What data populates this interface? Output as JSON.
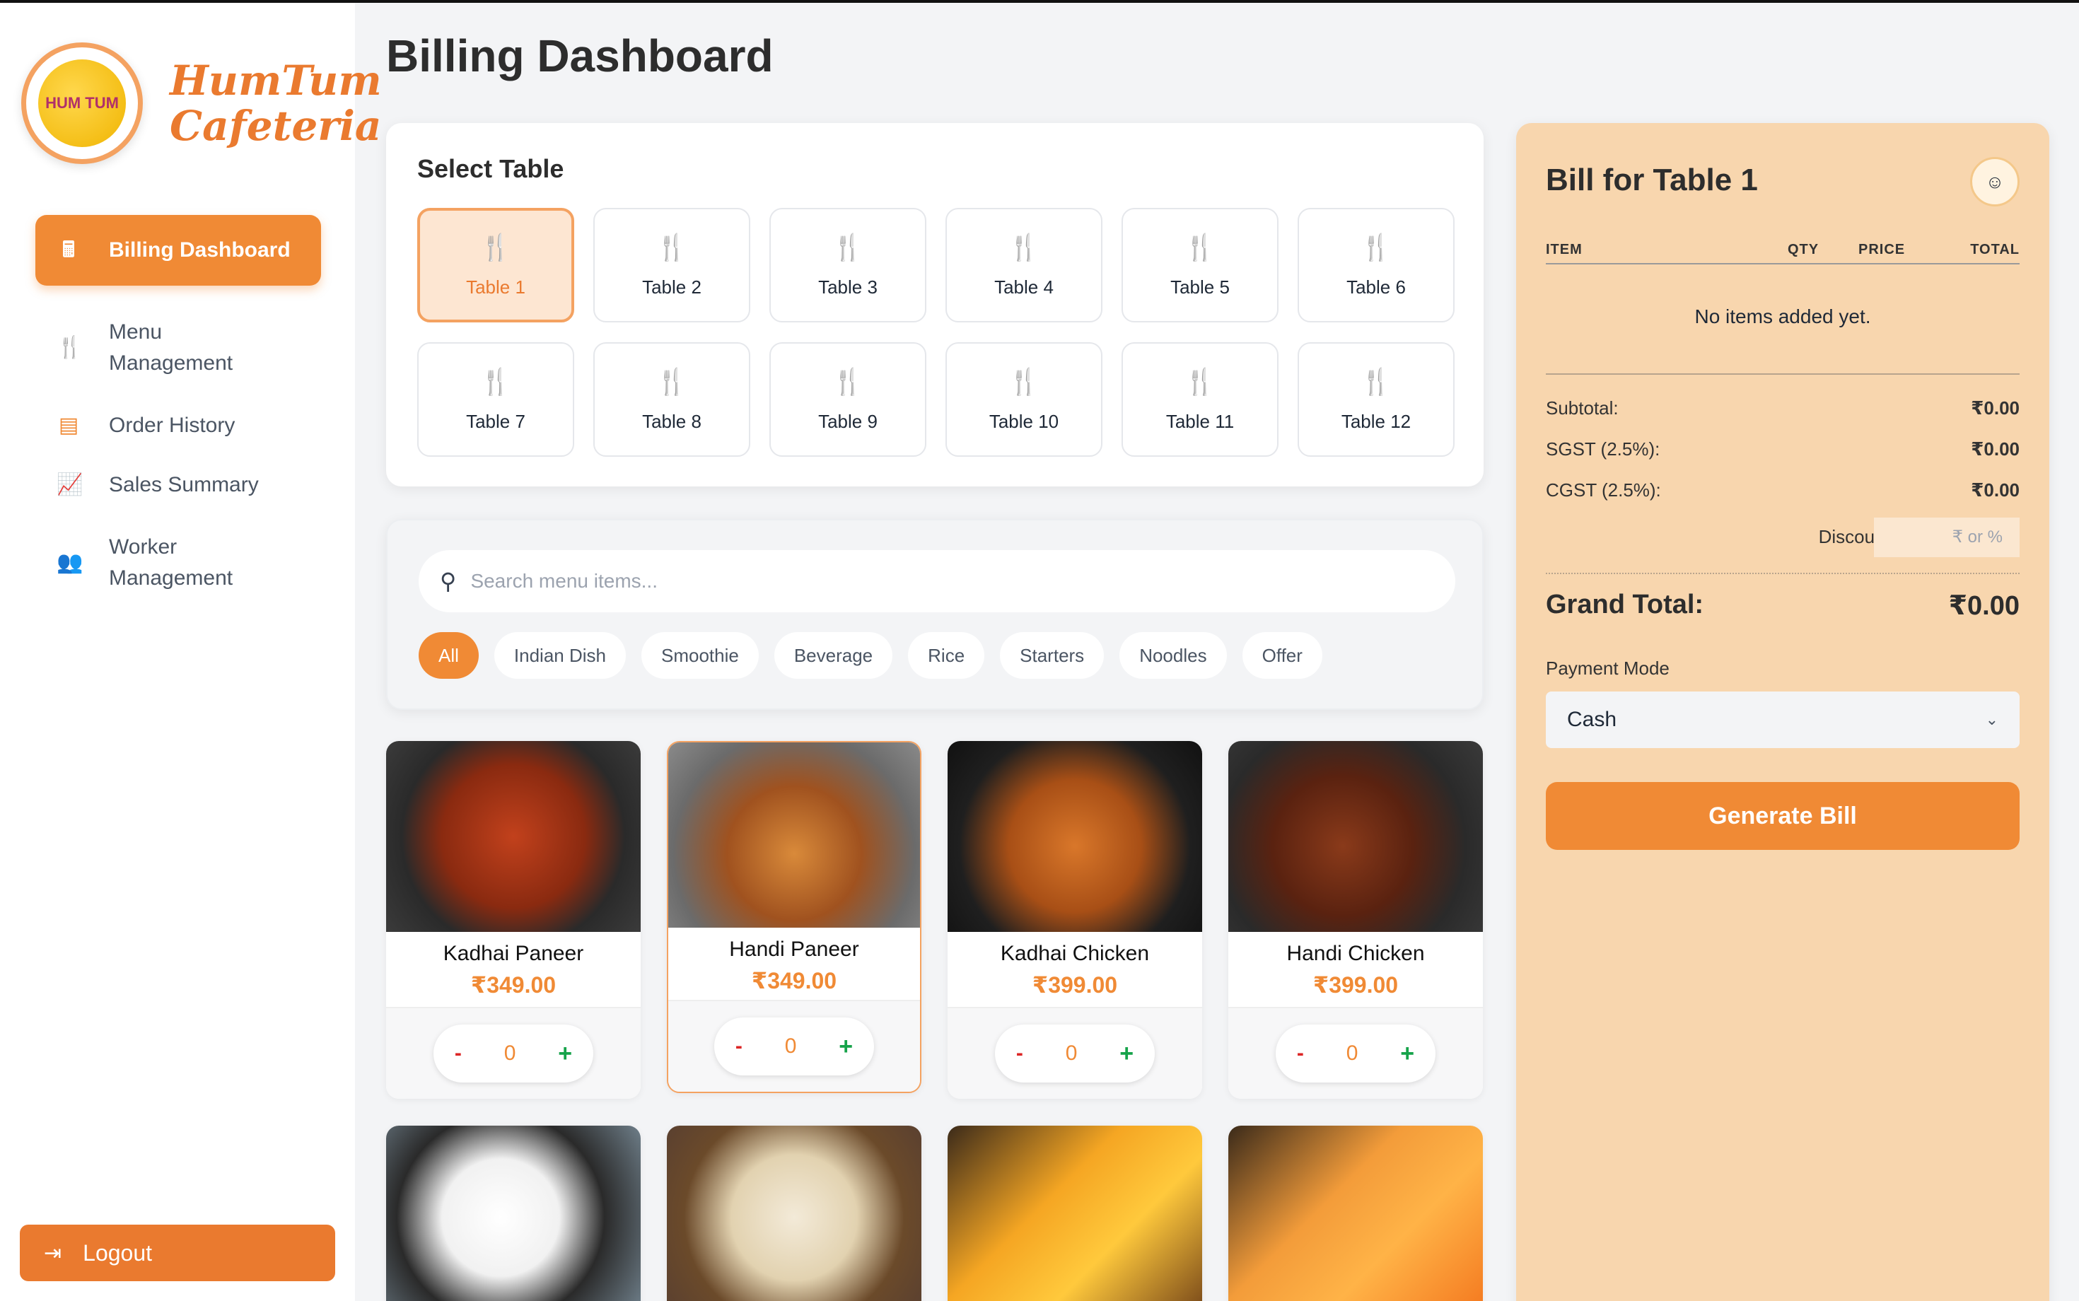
{
  "brand": {
    "logo_text_line1": "HumTum",
    "logo_text_line2": "Cafeteria",
    "logo_inner": "HUM TUM"
  },
  "sidebar": {
    "items": [
      {
        "label": "Billing Dashboard",
        "icon": "cash-register-icon"
      },
      {
        "label_line1": "Menu",
        "label_line2": "Management",
        "icon": "utensils-icon"
      },
      {
        "label": "Order History",
        "icon": "receipt-icon"
      },
      {
        "label": "Sales Summary",
        "icon": "chart-line-icon"
      },
      {
        "label_line1": "Worker",
        "label_line2": "Management",
        "icon": "users-icon"
      }
    ],
    "logout": "Logout"
  },
  "page": {
    "title": "Billing Dashboard"
  },
  "tables": {
    "heading": "Select Table",
    "selected": "Table 1",
    "list": [
      "Table 1",
      "Table 2",
      "Table 3",
      "Table 4",
      "Table 5",
      "Table 6",
      "Table 7",
      "Table 8",
      "Table 9",
      "Table 10",
      "Table 11",
      "Table 12"
    ]
  },
  "search": {
    "placeholder": "Search menu items..."
  },
  "categories": [
    "All",
    "Indian Dish",
    "Smoothie",
    "Beverage",
    "Rice",
    "Starters",
    "Noodles",
    "Offer"
  ],
  "menu": [
    {
      "name": "Kadhai Paneer",
      "price": "₹349.00",
      "qty": "0"
    },
    {
      "name": "Handi Paneer",
      "price": "₹349.00",
      "qty": "0"
    },
    {
      "name": "Kadhai Chicken",
      "price": "₹399.00",
      "qty": "0"
    },
    {
      "name": "Handi Chicken",
      "price": "₹399.00",
      "qty": "0"
    }
  ],
  "qty_controls": {
    "minus": "-",
    "plus": "+"
  },
  "bill": {
    "title": "Bill for Table 1",
    "columns": {
      "item": "ITEM",
      "qty": "QTY",
      "price": "PRICE",
      "total": "TOTAL"
    },
    "empty_message": "No items added yet.",
    "subtotal_label": "Subtotal:",
    "subtotal": "₹0.00",
    "sgst_label": "SGST (2.5%):",
    "sgst": "₹0.00",
    "cgst_label": "CGST (2.5%):",
    "cgst": "₹0.00",
    "discount_label": "Discount:",
    "discount_placeholder": "₹ or %",
    "grand_total_label": "Grand Total:",
    "grand_total": "₹0.00",
    "payment_label": "Payment Mode",
    "payment_mode": "Cash",
    "generate": "Generate Bill"
  },
  "colors": {
    "accent": "#f08a35",
    "bill_bg": "#f8d6ae",
    "plus": "#16a34a",
    "minus": "#dc2626"
  }
}
